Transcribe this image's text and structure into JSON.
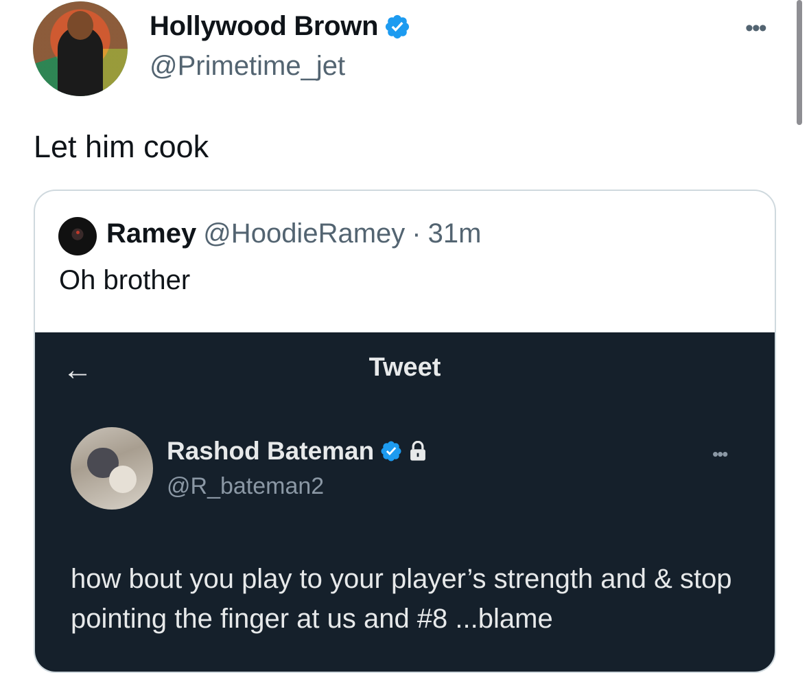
{
  "tweet": {
    "author_name": "Hollywood Brown",
    "author_handle": "@Primetime_jet",
    "text": "Let him cook",
    "more_icon": "more-dots-icon",
    "verified_color": "#1d9bf0"
  },
  "quoted": {
    "author_name": "Ramey",
    "author_handle": "@HoodieRamey",
    "separator": "·",
    "time": "31m",
    "text": "Oh brother"
  },
  "screenshot": {
    "back_glyph": "←",
    "title": "Tweet",
    "author_name": "Rashod Bateman",
    "author_handle": "@R_bateman2",
    "text": "how bout you play to your player’s strength and & stop pointing the finger at us and #8 ...blame",
    "background": "#15202b"
  },
  "colors": {
    "text_primary": "#0f1419",
    "text_secondary": "#536471",
    "border": "#cfd9de",
    "verified": "#1d9bf0"
  }
}
